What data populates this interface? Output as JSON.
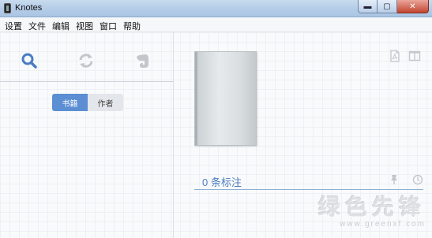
{
  "window": {
    "title": "Knotes",
    "minimize_glyph": "▬",
    "maximize_glyph": "▢",
    "close_glyph": "✕"
  },
  "menu": [
    "设置",
    "文件",
    "编辑",
    "视图",
    "窗口",
    "帮助"
  ],
  "left_toolbar": {
    "icons": [
      "search-icon",
      "sync-icon",
      "evernote-icon"
    ],
    "icon_color_active": "#4a7cc4",
    "icon_color_inactive": "#c3c7cc"
  },
  "segment": {
    "active_label": "书籍",
    "inactive_label": "作者",
    "active_color": "#5b8ed3"
  },
  "right_panel": {
    "top_icons": [
      "pdf-icon",
      "two-column-icon"
    ],
    "annotation_count_text": "0 条标注",
    "annotation_icons": [
      "pin-icon",
      "clock-icon"
    ]
  },
  "watermark": {
    "big_text": "绿色先锋",
    "small_text": "www.greenxf.com"
  }
}
